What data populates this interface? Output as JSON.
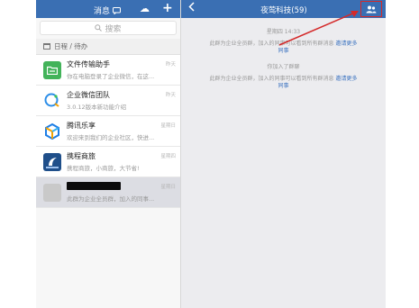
{
  "left_header": {
    "title": "消息",
    "plus": "+"
  },
  "search": {
    "placeholder": "搜索"
  },
  "agenda": {
    "label": "日程 / 待办"
  },
  "chats": [
    {
      "name": "文件传输助手",
      "preview": "你在电脑登录了企业微信，在这...",
      "time": "昨天",
      "color": "#43b35a"
    },
    {
      "name": "企业微信团队",
      "preview": "3.0.12版本新功能介绍",
      "time": "昨天",
      "color": "#ffffff"
    },
    {
      "name": "腾讯乐享",
      "preview": "欢迎来到我们的企业社区，快进...",
      "time": "星期日",
      "color": "#ffffff"
    },
    {
      "name": "携程商旅",
      "preview": "携程商旅，小商旅，大节省!",
      "time": "星期四",
      "color": "#1f4f8a"
    },
    {
      "name": "",
      "preview": "此群为企业全员群，加入的同事...",
      "time": "星期日",
      "color": "#ffffff"
    }
  ],
  "right_header": {
    "title": "夜莺科技(59)"
  },
  "messages": {
    "time": "星期四 14:33",
    "sys1_text": "此群为企业全员群，加入的同事可以看到所有群消息",
    "sys1_link1": "邀请更多",
    "sys1_link2": "同事",
    "joined": "你加入了群聊",
    "sys2_text": "此群为企业全员群，加入的同事可以看到所有群消息",
    "sys2_link1": "邀请更多",
    "sys2_link2": "同事"
  },
  "icons": {
    "chat-bubble": "chat-bubble-icon",
    "cloud": "cloud-icon",
    "members": "members-icon",
    "arrow": "red-arrow-annotation"
  },
  "colors": {
    "header": "#3a6fb3",
    "highlight": "#d42a2a",
    "link": "#3a72c0"
  }
}
